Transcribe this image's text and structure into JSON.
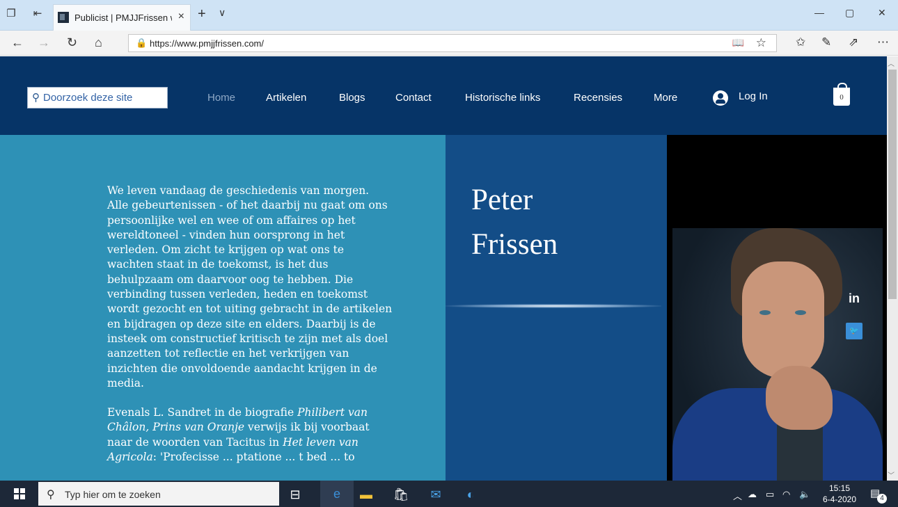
{
  "browser": {
    "tab_title": "Publicist | PMJJFrissen w",
    "tab_close": "×",
    "new_tab": "+",
    "tab_menu": "∨",
    "url": "https://www.pmjjfrissen.com/",
    "window_controls": {
      "minimize": "—",
      "restore": "▢",
      "close": "✕"
    }
  },
  "site": {
    "search_placeholder": "Doorzoek deze site",
    "nav": [
      "Home",
      "Artikelen",
      "Blogs",
      "Contact",
      "Historische links",
      "Recensies",
      "More"
    ],
    "login": "Log In",
    "cart_count": "0",
    "name_line1": "Peter",
    "name_line2": "Frissen",
    "intro": "We leven vandaag de geschiedenis van morgen. Alle gebeurtenissen - of het daarbij nu gaat om ons persoonlijke wel en wee of om affaires op het wereldtoneel - vinden hun oorsprong in het verleden. Om zicht te krijgen op wat ons te wachten staat in de toekomst, is het dus behulpzaam om daarvoor oog te hebben. Die verbinding tussen verleden, heden en toekomst wordt gezocht en tot uiting gebracht in de artikelen en bijdragen op deze site en elders. Daarbij is de insteek om constructief kritisch te zijn met als doel aanzetten tot reflectie en het verkrijgen van inzichten die onvoldoende aandacht krijgen in de media.",
    "para2_before": "Evenals L. Sandret in de biografie ",
    "para2_book": "Philibert van Châlon, Prins van Oranje",
    "para2_middle": " verwijs ik bij voorbaat naar de woorden van Tacitus in ",
    "para2_book2": "Het leven van Agricola",
    "para2_after": ": 'Profecisse ... ptatione ... t bed ... to",
    "social": {
      "linkedin": "in",
      "twitter": "🐦"
    }
  },
  "taskbar": {
    "search_placeholder": "Typ hier om te zoeken",
    "time": "15:15",
    "date": "6-4-2020",
    "notifications": "4"
  },
  "colors": {
    "header": "#063467",
    "left_panel": "#2e91b6",
    "mid_panel": "#134d87",
    "taskbar": "#1d2838"
  }
}
